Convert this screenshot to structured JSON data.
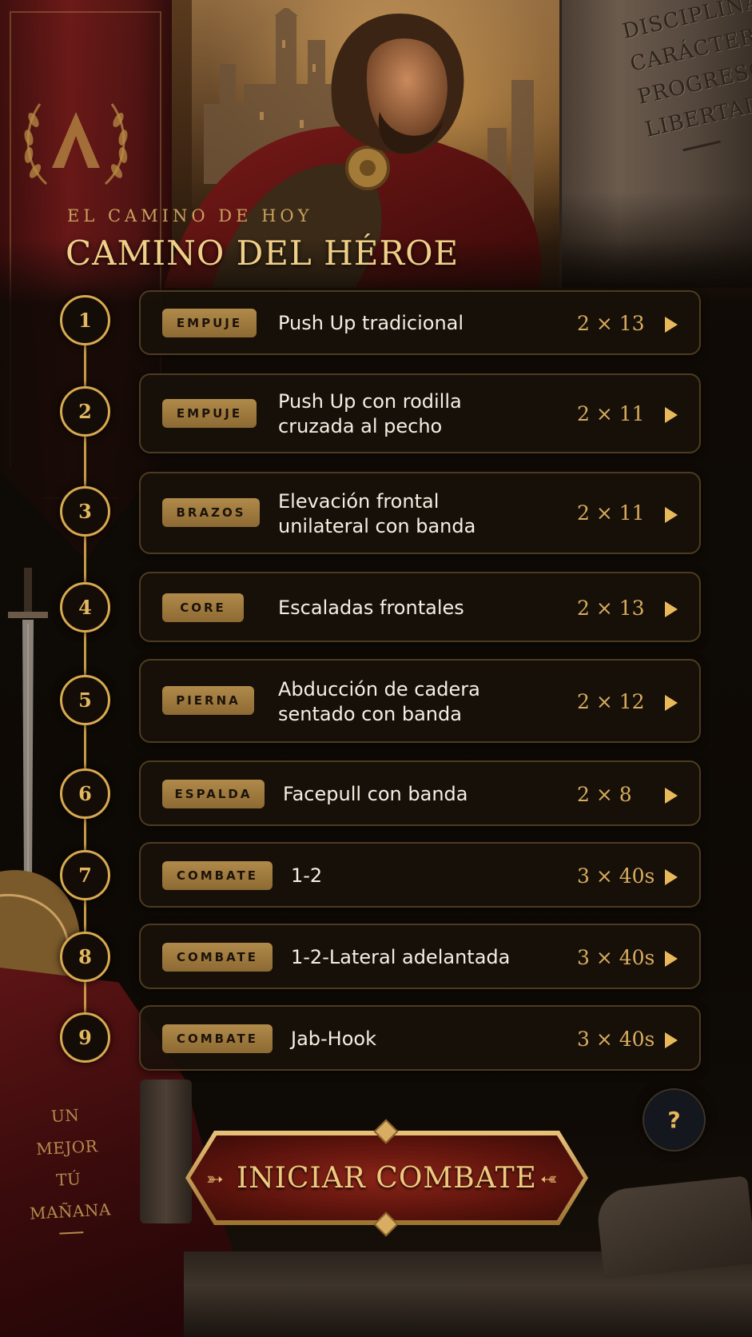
{
  "header": {
    "kicker": "EL CAMINO DE HOY",
    "title": "CAMINO DEL HÉROE"
  },
  "pillar_words": [
    "DISCIPLINA",
    "CARÁCTER",
    "PROGRESO",
    "LIBERTAD"
  ],
  "exercises": [
    {
      "number": "1",
      "category": "EMPUJE",
      "name": "Push Up tradicional",
      "reps": "2 × 13"
    },
    {
      "number": "2",
      "category": "EMPUJE",
      "name": "Push Up con rodilla cruzada al pecho",
      "reps": "2 × 11"
    },
    {
      "number": "3",
      "category": "BRAZOS",
      "name": "Elevación frontal unilateral con banda",
      "reps": "2 × 11"
    },
    {
      "number": "4",
      "category": "CORE",
      "name": "Escaladas frontales",
      "reps": "2 × 13"
    },
    {
      "number": "5",
      "category": "PIERNA",
      "name": "Abducción de cadera sentado con banda",
      "reps": "2 × 12"
    },
    {
      "number": "6",
      "category": "ESPALDA",
      "name": "Facepull con banda",
      "reps": "2 × 8"
    },
    {
      "number": "7",
      "category": "COMBATE",
      "name": "1-2",
      "reps": "3 × 40s"
    },
    {
      "number": "8",
      "category": "COMBATE",
      "name": "1-2-Lateral adelantada",
      "reps": "3 × 40s"
    },
    {
      "number": "9",
      "category": "COMBATE",
      "name": "Jab-Hook",
      "reps": "3 × 40s"
    }
  ],
  "help_label": "?",
  "cta_label": "INICIAR COMBATE",
  "cloth_words": [
    "UN",
    "MEJOR",
    "TÚ",
    "MAÑANA"
  ],
  "colors": {
    "accent_gold": "#e8b85b",
    "card_bg": "#18110a",
    "banner_red": "#6d1718",
    "cta_red": "#8a2418"
  }
}
